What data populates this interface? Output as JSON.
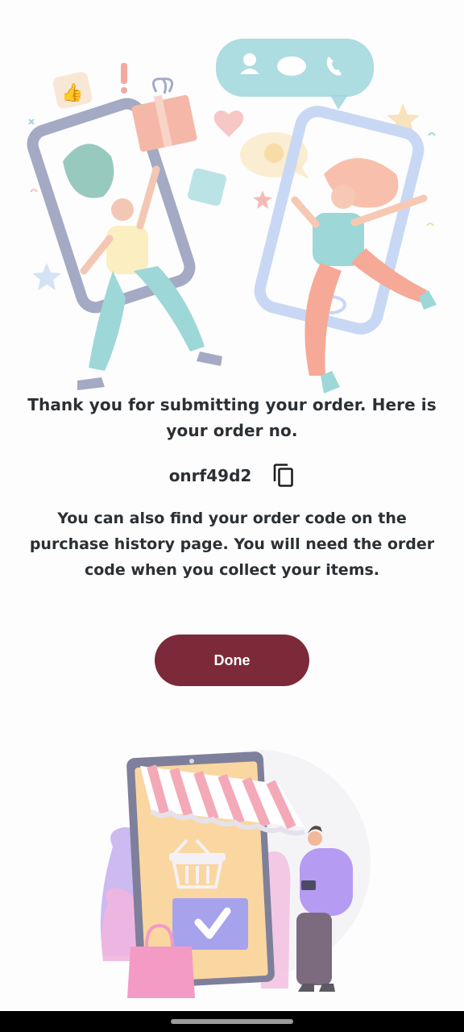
{
  "confirmation": {
    "thank_you_text": "Thank you for submitting your order. Here is your order no.",
    "order_number": "onrf49d2",
    "info_text": "You can also find your order code on the purchase history page. You will need the order code when you collect your items."
  },
  "actions": {
    "done_label": "Done"
  },
  "icons": {
    "copy": "copy-icon"
  },
  "colors": {
    "primary_button": "#7c2939",
    "text": "#2b3034",
    "background": "#fdfdfd"
  }
}
